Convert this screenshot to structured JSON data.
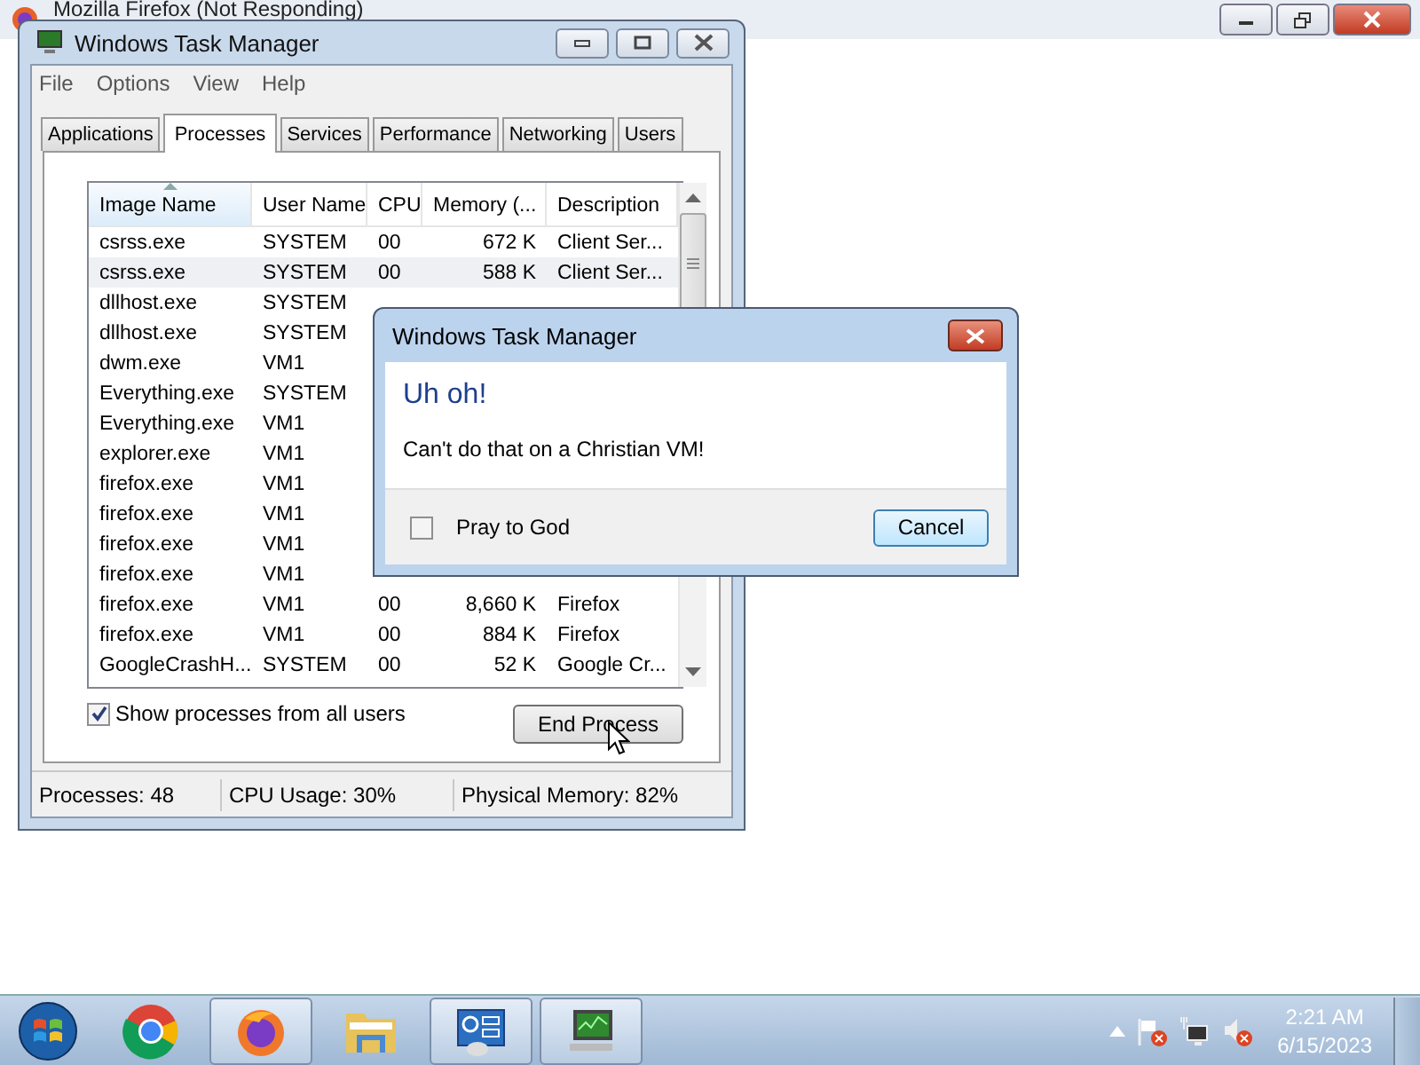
{
  "background_window": {
    "title": "Mozilla Firefox (Not Responding)"
  },
  "window": {
    "title": "Windows Task Manager",
    "menu": [
      "File",
      "Options",
      "View",
      "Help"
    ],
    "tabs": [
      {
        "label": "Applications",
        "selected": false
      },
      {
        "label": "Processes",
        "selected": true
      },
      {
        "label": "Services",
        "selected": false
      },
      {
        "label": "Performance",
        "selected": false
      },
      {
        "label": "Networking",
        "selected": false
      },
      {
        "label": "Users",
        "selected": false
      }
    ],
    "columns": [
      "Image Name",
      "User Name",
      "CPU",
      "Memory (...",
      "Description"
    ],
    "rows": [
      {
        "cells": [
          "csrss.exe",
          "SYSTEM",
          "00",
          "672 K",
          "Client Ser..."
        ],
        "selected": false
      },
      {
        "cells": [
          "csrss.exe",
          "SYSTEM",
          "00",
          "588 K",
          "Client Ser..."
        ],
        "selected": true
      },
      {
        "cells": [
          "dllhost.exe",
          "SYSTEM"
        ],
        "selected": false
      },
      {
        "cells": [
          "dllhost.exe",
          "SYSTEM"
        ],
        "selected": false
      },
      {
        "cells": [
          "dwm.exe",
          "VM1"
        ],
        "selected": false
      },
      {
        "cells": [
          "Everything.exe",
          "SYSTEM"
        ],
        "selected": false
      },
      {
        "cells": [
          "Everything.exe",
          "VM1"
        ],
        "selected": false
      },
      {
        "cells": [
          "explorer.exe",
          "VM1"
        ],
        "selected": false
      },
      {
        "cells": [
          "firefox.exe",
          "VM1"
        ],
        "selected": false
      },
      {
        "cells": [
          "firefox.exe",
          "VM1"
        ],
        "selected": false
      },
      {
        "cells": [
          "firefox.exe",
          "VM1"
        ],
        "selected": false
      },
      {
        "cells": [
          "firefox.exe",
          "VM1"
        ],
        "selected": false
      },
      {
        "cells": [
          "firefox.exe",
          "VM1",
          "00",
          "8,660 K",
          "Firefox"
        ],
        "selected": false
      },
      {
        "cells": [
          "firefox.exe",
          "VM1",
          "00",
          "884 K",
          "Firefox"
        ],
        "selected": false
      },
      {
        "cells": [
          "GoogleCrashH...",
          "SYSTEM",
          "00",
          "52 K",
          "Google Cr..."
        ],
        "selected": false
      }
    ],
    "show_all_users": {
      "label": "Show processes from all users",
      "checked": true
    },
    "end_process_button": "End Process",
    "status_bar": [
      "Processes: 48",
      "CPU Usage: 30%",
      "Physical Memory: 82%"
    ]
  },
  "dialog": {
    "title": "Windows Task Manager",
    "heading": "Uh oh!",
    "message": "Can't do that on a Christian VM!",
    "checkbox": {
      "label": "Pray to God",
      "checked": false
    },
    "button": "Cancel"
  },
  "taskbar": {
    "apps": [
      {
        "kind": "start",
        "running": false
      },
      {
        "kind": "chrome",
        "running": false
      },
      {
        "kind": "firefox",
        "running": true
      },
      {
        "kind": "folder",
        "running": false
      },
      {
        "kind": "control-panel",
        "running": true
      },
      {
        "kind": "monitor",
        "running": true
      }
    ],
    "clock": {
      "time": "2:21 AM",
      "date": "6/15/2023"
    }
  }
}
